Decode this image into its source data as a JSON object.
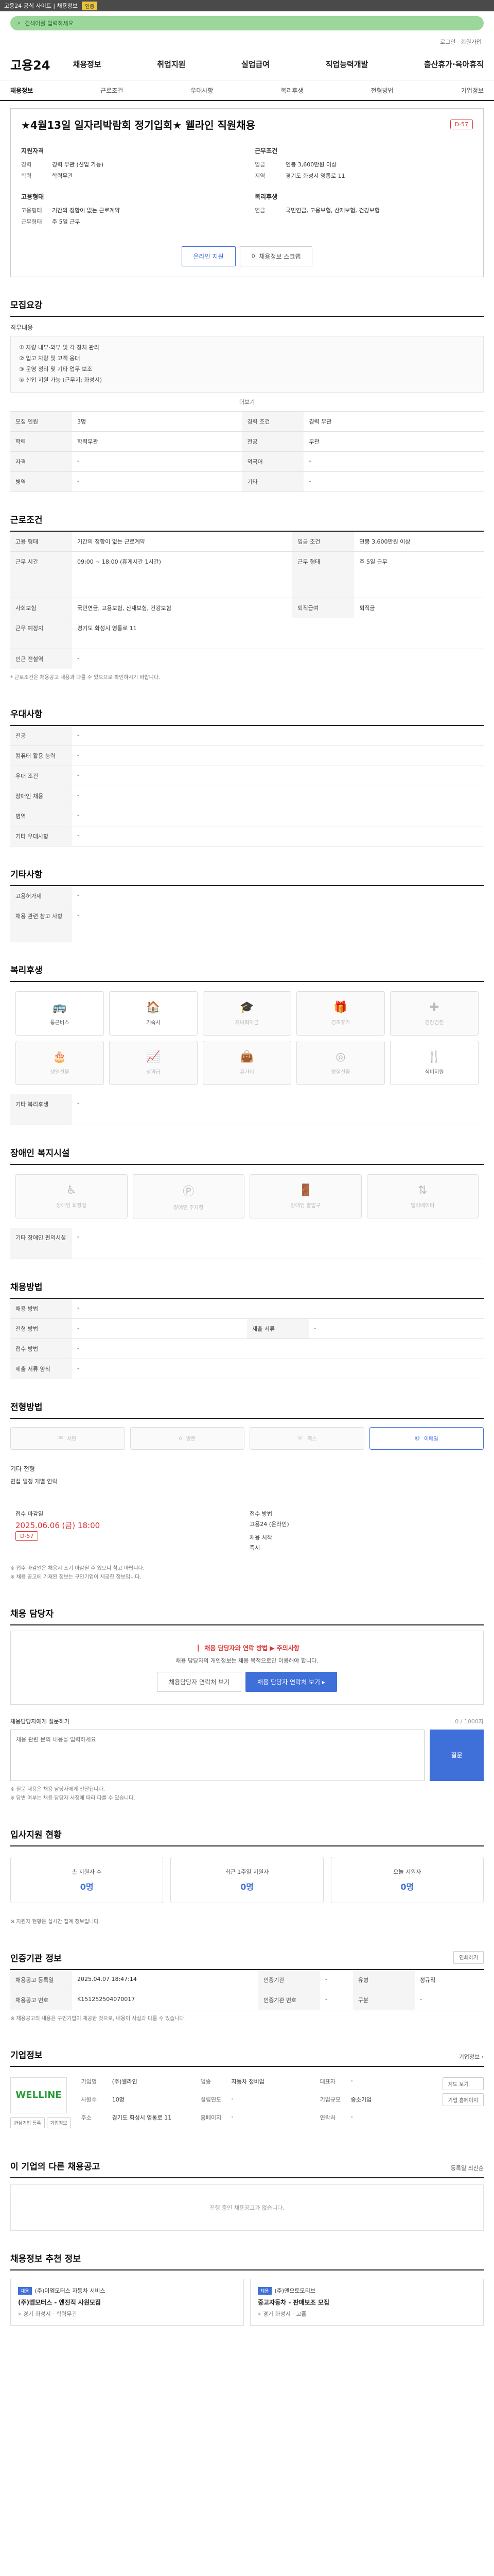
{
  "topbar": {
    "text": "고용24 공식 사이트 | 채용정보",
    "badge": "인증"
  },
  "search": {
    "placeholder": "검색어를 입력하세요"
  },
  "subbar": {
    "links": [
      "로그인",
      "회원가입"
    ]
  },
  "gnb": {
    "logo": "고용24",
    "menu": [
      "채용정보",
      "취업지원",
      "실업급여",
      "직업능력개발",
      "출산휴가·육아휴직"
    ]
  },
  "tabs": [
    "채용정보",
    "근로조건",
    "우대사항",
    "복리후생",
    "전형방법",
    "기업정보"
  ],
  "title": {
    "text": "★4월13일 일자리박람회 정기입회★ 웰라인 직원채용",
    "dday": "D-57"
  },
  "overview": {
    "left_title": "지원자격",
    "left": [
      {
        "k": "경력",
        "v": "경력 무관 (신입 가능)"
      },
      {
        "k": "학력",
        "v": "학력무관"
      }
    ],
    "right_title": "근무조건",
    "right": [
      {
        "k": "임금",
        "v": "연봉 3,600만원 이상"
      },
      {
        "k": "지역",
        "v": "경기도 화성시 영통로 11"
      }
    ],
    "left2_title": "고용형태",
    "left2": [
      {
        "k": "고용형태",
        "v": "기간의 정함이 없는 근로계약"
      },
      {
        "k": "근무형태",
        "v": "주 5일 근무"
      }
    ],
    "right2_title": "복리후생",
    "right2": [
      {
        "k": "연금",
        "v": "국민연금, 고용보험, 산재보험, 건강보험"
      }
    ]
  },
  "buttons": {
    "apply": "온라인 지원",
    "scrap": "이 채용정보 스크랩"
  },
  "sections": {
    "recruit": "모집요강",
    "conditions": "근로조건",
    "preference": "우대사항",
    "etc": "기타사항",
    "welfare": "복리후생",
    "disabled": "장애인 복지시설",
    "process": "채용방법",
    "contact": "전형방법",
    "manager": "채용 담당자",
    "stats": "입사지원 현황",
    "agency": "인증기관 정보",
    "company": "기업정보",
    "other": "이 기업의 다른 채용공고",
    "similar": "채용정보 추천 정보"
  },
  "recruit": {
    "duty_label": "직무내용",
    "duty": [
      "① 차량 내부·외부 및 각 장치 관리",
      "② 입고 차량 및 고객 응대",
      "③ 운영 정리 및 기타 업무 보조",
      "④ 신입 지원 가능 (근무지: 화성시)"
    ],
    "rows": [
      {
        "k": "모집 인원",
        "v": "3명",
        "k2": "경력 조건",
        "v2": "경력 무관"
      },
      {
        "k": "학력",
        "v": "학력무관",
        "k2": "전공",
        "v2": "무관"
      },
      {
        "k": "자격",
        "v": "-",
        "k2": "외국어",
        "v2": "-"
      },
      {
        "k": "병역",
        "v": "-",
        "k2": "기타",
        "v2": "-"
      }
    ],
    "more": "더보기"
  },
  "conditions": {
    "rows": [
      {
        "k": "고용 형태",
        "v": "기간의 정함이 없는 근로계약"
      },
      {
        "k": "임금 조건",
        "v": "연봉 3,600만원 이상"
      },
      {
        "k": "근무 시간",
        "v": "09:00 ~ 18:00 (휴게시간 1시간)"
      },
      {
        "k": "근무 형태",
        "v": "주 5일 근무"
      },
      {
        "k": "사회보험",
        "v": "국민연금, 고용보험, 산재보험, 건강보험"
      },
      {
        "k": "근무 예정지",
        "v": "경기도 화성시 영통로 11"
      },
      {
        "k": "인근 전철역",
        "v": "-"
      },
      {
        "k": "퇴직급여",
        "v": "퇴직금"
      }
    ],
    "note": "* 근로조건은 채용공고 내용과 다를 수 있으므로 확인하시기 바랍니다."
  },
  "preference": {
    "rows": [
      {
        "k": "전공",
        "v": "-"
      },
      {
        "k": "컴퓨터 활용 능력",
        "v": "-"
      },
      {
        "k": "우대 조건",
        "v": "-"
      },
      {
        "k": "장애인 채용",
        "v": "-"
      },
      {
        "k": "병역",
        "v": "-"
      },
      {
        "k": "기타 우대사항",
        "v": "-"
      }
    ]
  },
  "etc": {
    "rows": [
      {
        "k": "고용허가제",
        "v": "-"
      },
      {
        "k": "채용 관련 참고 사항",
        "v": "-"
      }
    ]
  },
  "welfare": {
    "items": [
      {
        "icon": "car-icon",
        "label": "통근버스",
        "on": true
      },
      {
        "icon": "meal-icon",
        "label": "기숙사",
        "on": true
      },
      {
        "icon": "bonus-icon",
        "label": "자녀학자금",
        "on": false
      },
      {
        "icon": "gift-icon",
        "label": "경조휴가",
        "on": false
      },
      {
        "icon": "health-icon",
        "label": "건강검진",
        "on": false
      },
      {
        "icon": "cake-icon",
        "label": "생일선물",
        "on": false
      },
      {
        "icon": "chart-icon",
        "label": "성과급",
        "on": false
      },
      {
        "icon": "bag-icon",
        "label": "휴가비",
        "on": false
      },
      {
        "icon": "coin-icon",
        "label": "명절선물",
        "on": false
      },
      {
        "icon": "clock-icon",
        "label": "식비지원",
        "on": true
      }
    ],
    "extra_label": "기타 복리후생",
    "extra": "-"
  },
  "disabled": {
    "items": [
      "장애인 화장실",
      "장애인 주차장",
      "장애인 출입구",
      "엘리베이터"
    ],
    "extra_label": "기타 장애인 편의시설",
    "extra": "-"
  },
  "process": {
    "rows": [
      {
        "k": "채용 방법",
        "v": "-",
        "k2": "",
        "v2": ""
      },
      {
        "k": "전형 방법",
        "v": "-",
        "k2": "제출 서류",
        "v2": "-"
      },
      {
        "k": "접수 방법",
        "v": "-",
        "k2": "",
        "v2": ""
      },
      {
        "k": "제출 서류 양식",
        "v": "-",
        "k2": "",
        "v2": ""
      }
    ]
  },
  "contact": {
    "options": [
      "서면",
      "방문",
      "팩스",
      "이메일"
    ],
    "selected": 3,
    "label": "기타 전형",
    "value": "면접 일정 개별 연락"
  },
  "deadline": {
    "left_label": "접수 마감일",
    "left_date": "2025.06.06 (금) 18:00",
    "left_tag": "D-57",
    "right_label": "접수 방법",
    "right_val": "고용24 (온라인)",
    "right2_label": "채용 시작",
    "right2_val": "즉시",
    "notes": [
      "※ 접수 마감일은 채용시 조기 마감될 수 있으니 참고 바랍니다.",
      "※ 채용 공고에 기재된 정보는 구인기업이 제공한 정보입니다."
    ]
  },
  "manager": {
    "title": "채용 담당자와 연락 방법 ▶ 주의사항",
    "body": "채용 담당자의 개인정보는 채용 목적으로만 이용해야 합니다.",
    "btn1": "채용담당자 연락처 보기",
    "btn2": "채용 담당자 연락처 보기 ▸"
  },
  "qa": {
    "label": "채용담당자에게 질문하기",
    "counter": "0 / 1000자",
    "placeholder": "채용 관련 문의 내용을 입력하세요.",
    "send": "질문",
    "notes": [
      "※ 질문 내용은 채용 담당자에게 전달됩니다.",
      "※ 답변 여부는 채용 담당자 사정에 따라 다를 수 있습니다."
    ]
  },
  "stats": [
    {
      "label": "총 지원자 수",
      "value": "0명"
    },
    {
      "label": "최근 1주일 지원자",
      "value": "0명"
    },
    {
      "label": "오늘 지원자",
      "value": "0명"
    }
  ],
  "stats_note": "※ 지원자 현황은 실시간 집계 정보입니다.",
  "agency": {
    "print": "인쇄하기",
    "rows": [
      {
        "k": "채용공고 등록일",
        "v": "2025.04.07 18:47:14",
        "k2": "인증기관",
        "v2": "-",
        "k3": "유형",
        "v3": "정규직"
      },
      {
        "k": "채용공고 번호",
        "v": "K151252504070017",
        "k2": "인증기관 번호",
        "v2": "-",
        "k3": "구분",
        "v3": "-"
      }
    ],
    "note": "※ 채용공고의 내용은 구인기업이 제공한 것으로, 내용이 사실과 다를 수 있습니다."
  },
  "company": {
    "logo": "WELLINE",
    "name": "(주)웰라인",
    "rows": [
      {
        "k": "기업명",
        "v": "(주)웰라인"
      },
      {
        "k": "업종",
        "v": "자동차 정비업"
      },
      {
        "k": "대표자",
        "v": "-"
      },
      {
        "k": "사원수",
        "v": "10명"
      },
      {
        "k": "설립연도",
        "v": "-"
      },
      {
        "k": "기업규모",
        "v": "중소기업"
      },
      {
        "k": "주소",
        "v": "경기도 화성시 영통로 11"
      },
      {
        "k": "홈페이지",
        "v": "-"
      },
      {
        "k": "연락처",
        "v": "-"
      }
    ],
    "more": "기업정보 ›",
    "btn_interest": "관심기업 등록",
    "btn_follow": "기업정보",
    "btn_map": "지도 보기",
    "btn_page": "기업 홈페이지"
  },
  "other": {
    "sort": "등록일 최신순",
    "empty": "진행 중인 채용공고가 없습니다."
  },
  "similar": [
    {
      "tag": "채용",
      "company": "(주)이엠모터스 자동차 서비스",
      "title": "(주)엠모터스 - 엔진직 사원모집",
      "loc": "경기 화성시",
      "edu": "학력무관"
    },
    {
      "tag": "채용",
      "company": "(주)엔오토모티브",
      "title": "중고자동차 - 판매보조 모집",
      "loc": "경기 화성시",
      "edu": "고졸"
    }
  ]
}
